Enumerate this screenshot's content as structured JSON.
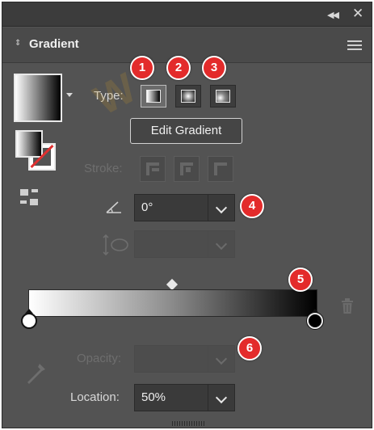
{
  "titlebar": {
    "collapse_icon": "double-chevron-left-icon",
    "close_icon": "close-icon"
  },
  "panel": {
    "title": "Gradient",
    "menu_icon": "hamburger-menu-icon"
  },
  "type": {
    "label": "Type:",
    "options": [
      {
        "name": "Linear",
        "icon": "linear-gradient-icon",
        "selected": true
      },
      {
        "name": "Radial",
        "icon": "radial-gradient-icon",
        "selected": false
      },
      {
        "name": "Freeform",
        "icon": "freeform-gradient-icon",
        "selected": false
      }
    ]
  },
  "edit_gradient_label": "Edit Gradient",
  "stroke": {
    "label": "Stroke:",
    "enabled": false
  },
  "angle": {
    "value": "0°",
    "icon": "angle-icon"
  },
  "aspect_ratio": {
    "value": "",
    "icon": "aspect-ratio-icon",
    "enabled": false
  },
  "gradient": {
    "stops": [
      {
        "color": "#ffffff",
        "location_percent": 0
      },
      {
        "color": "#000000",
        "location_percent": 100
      }
    ],
    "midpoint_percent": 50
  },
  "opacity": {
    "label": "Opacity:",
    "value": "",
    "enabled": false
  },
  "location": {
    "label": "Location:",
    "value": "50%"
  },
  "badges": [
    "1",
    "2",
    "3",
    "4",
    "5",
    "6"
  ],
  "watermark": "W",
  "colors": {
    "panel_bg": "#535353",
    "badge_red": "#e32b2b"
  }
}
